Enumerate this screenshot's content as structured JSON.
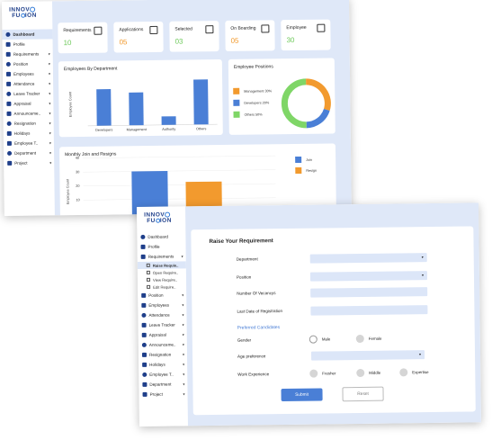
{
  "brand": {
    "line1_a": "INNOV",
    "line1_b": "",
    "line2_a": "FU",
    "line2_b": "ION"
  },
  "sidebar1": {
    "items": [
      {
        "label": "Dashboard",
        "caret": ""
      },
      {
        "label": "Profile",
        "caret": ""
      },
      {
        "label": "Requirements",
        "caret": "▾"
      },
      {
        "label": "Position",
        "caret": "▾"
      },
      {
        "label": "Employees",
        "caret": "▾"
      },
      {
        "label": "Attendance",
        "caret": "▾"
      },
      {
        "label": "Leave Tracker",
        "caret": "▾"
      },
      {
        "label": "Appraisal",
        "caret": "▾"
      },
      {
        "label": "Announceme..",
        "caret": "▾"
      },
      {
        "label": "Resignation",
        "caret": "▾"
      },
      {
        "label": "Holidays",
        "caret": "▾"
      },
      {
        "label": "Employee T..",
        "caret": "▾"
      },
      {
        "label": "Department",
        "caret": "▾"
      },
      {
        "label": "Project",
        "caret": "▾"
      }
    ]
  },
  "stats": [
    {
      "title": "Requirements",
      "value": "10"
    },
    {
      "title": "Applications",
      "value": "05"
    },
    {
      "title": "Selected",
      "value": "03"
    },
    {
      "title": "On Boarding",
      "value": "05"
    },
    {
      "title": "Employee",
      "value": "30"
    }
  ],
  "dept_chart": {
    "title": "Employees By Department"
  },
  "positions_chart": {
    "title": "Employee Positions"
  },
  "monthly_chart": {
    "title": "Monthly Join and Resigns"
  },
  "chart_data": [
    {
      "type": "bar",
      "title": "Employees By Department",
      "ylabel": "Employee Count",
      "categories": [
        "Developers",
        "Management",
        "Authority",
        "Others"
      ],
      "values": [
        30,
        27,
        7,
        37
      ],
      "ylim": [
        0,
        40
      ],
      "color": "#4a7fd6"
    },
    {
      "type": "pie",
      "title": "Employee Positions",
      "labels": [
        "Management 30%",
        "Developers 20%",
        "Others 50%"
      ],
      "values": [
        30,
        20,
        50
      ],
      "colors": [
        "#f29a2e",
        "#4a7fd6",
        "#7fd667"
      ],
      "legend": "left"
    },
    {
      "type": "bar",
      "title": "Monthly Join and Resigns",
      "ylabel": "Employee Count",
      "yticks": [
        "40",
        "30",
        "20",
        "10"
      ],
      "series": [
        {
          "name": "Join",
          "values": [
            32
          ],
          "color": "#4a7fd6"
        },
        {
          "name": "Resign",
          "values": [
            24
          ],
          "color": "#f29a2e"
        }
      ],
      "ylim": [
        0,
        45
      ],
      "legend": "right"
    }
  ],
  "sidebar2": {
    "items": [
      {
        "label": "Dashboard",
        "caret": "",
        "type": "item"
      },
      {
        "label": "Profile",
        "caret": "",
        "type": "item"
      },
      {
        "label": "Requirements",
        "caret": "▾",
        "type": "item"
      },
      {
        "label": "Raise Requie..",
        "caret": "",
        "type": "sub"
      },
      {
        "label": "Open Require..",
        "caret": "",
        "type": "sub"
      },
      {
        "label": "View Require..",
        "caret": "",
        "type": "sub"
      },
      {
        "label": "Edit Require..",
        "caret": "",
        "type": "sub"
      },
      {
        "label": "Position",
        "caret": "▾",
        "type": "item"
      },
      {
        "label": "Employees",
        "caret": "▾",
        "type": "item"
      },
      {
        "label": "Attendance",
        "caret": "▾",
        "type": "item"
      },
      {
        "label": "Leave Tracker",
        "caret": "▾",
        "type": "item"
      },
      {
        "label": "Appraisal",
        "caret": "▾",
        "type": "item"
      },
      {
        "label": "Announceme..",
        "caret": "▾",
        "type": "item"
      },
      {
        "label": "Resignation",
        "caret": "▾",
        "type": "item"
      },
      {
        "label": "Holidays",
        "caret": "▾",
        "type": "item"
      },
      {
        "label": "Employee T..",
        "caret": "▾",
        "type": "item"
      },
      {
        "label": "Department",
        "caret": "▾",
        "type": "item"
      },
      {
        "label": "Project",
        "caret": "▾",
        "type": "item"
      }
    ]
  },
  "form": {
    "title": "Raise Your Requirement",
    "department_label": "Department",
    "position_label": "Position",
    "vacancy_label": "Number Of Vecancys",
    "last_date_label": "Last Date of Registration",
    "preferred_heading": "Preferred Candidates",
    "gender_label": "Gender",
    "gender_options": [
      "Male",
      "Female"
    ],
    "age_label": "Age preference",
    "experience_label": "Work Experience",
    "experience_options": [
      "Fresher",
      "Middle",
      "Expertise"
    ],
    "caret": "▾",
    "submit_label": "Submit",
    "reset_label": "Reset"
  }
}
